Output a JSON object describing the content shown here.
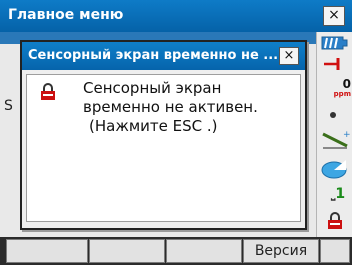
{
  "window": {
    "title": "Главное меню",
    "close_label": "×"
  },
  "dialog": {
    "title": "Сенсорный экран временно не ...",
    "close_label": "×",
    "message_line1": "Сенсорный экран",
    "message_line2": "временно не активен.",
    "message_line3": "(Нажмите ESC .)"
  },
  "background": {
    "partial_label": "S"
  },
  "status_icons": [
    {
      "name": "battery-icon",
      "color": "#2a7fc8"
    },
    {
      "name": "target-icon",
      "color": "#d01010"
    },
    {
      "name": "ppm-icon",
      "value": "0",
      "unit": "ppm"
    },
    {
      "name": "dot-icon"
    },
    {
      "name": "tilt-icon"
    },
    {
      "name": "laser-icon"
    },
    {
      "name": "channel-icon",
      "value": "1"
    },
    {
      "name": "lock-icon",
      "color": "#cc1010"
    }
  ],
  "function_keys": [
    "",
    "",
    "",
    "Версия",
    ""
  ]
}
